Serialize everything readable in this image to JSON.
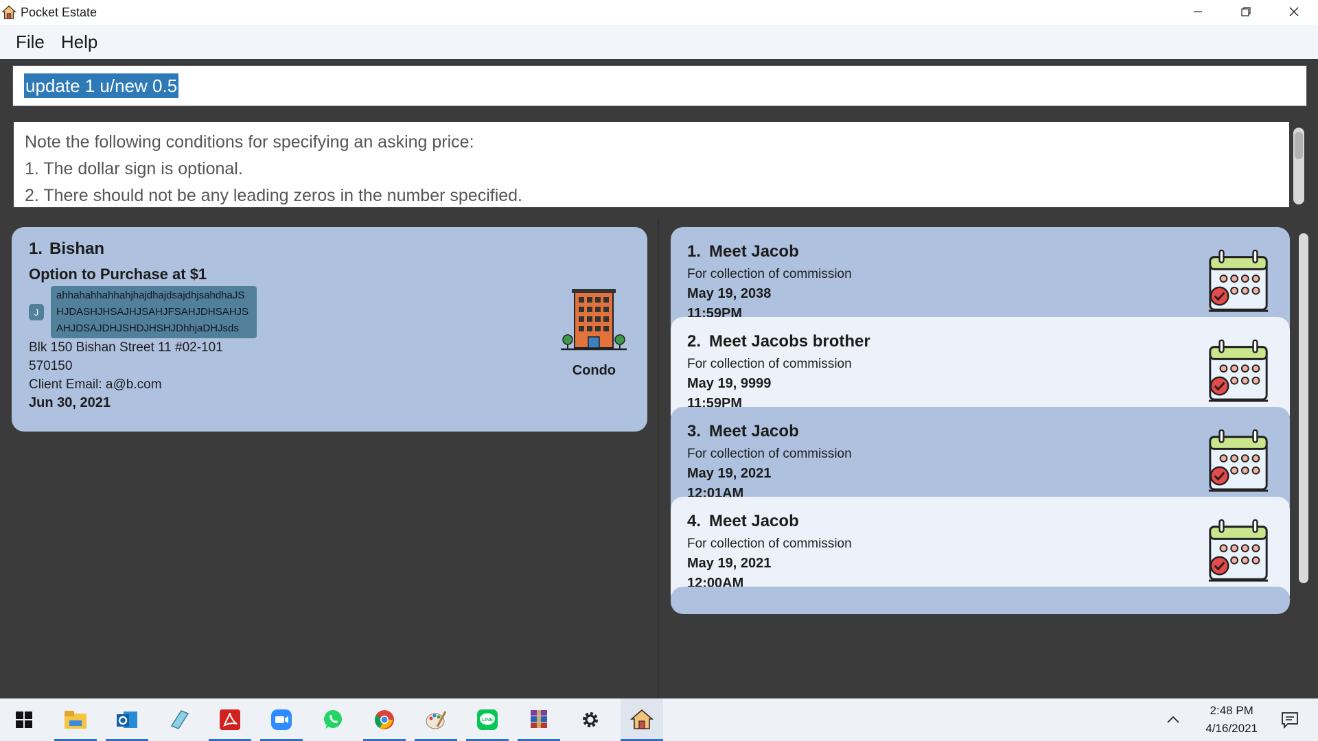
{
  "window": {
    "title": "Pocket Estate",
    "minimize_icon": "minimize-icon",
    "maximize_icon": "restore-icon",
    "close_icon": "close-icon"
  },
  "menu": {
    "items": [
      {
        "label": "File"
      },
      {
        "label": "Help"
      }
    ]
  },
  "command": {
    "value": "update 1 u/new 0.5"
  },
  "result": {
    "lines": [
      "Note the following conditions for specifying an asking price:",
      "1. The dollar sign is optional.",
      "2. There should not be any leading zeros in the number specified."
    ]
  },
  "properties": [
    {
      "index": "1.",
      "name": "Bishan",
      "status": "Option to Purchase at $1",
      "tags": [
        "J",
        "ahhahahhahhahjhajdhajdsajdhjsahdhaJSHJDASHJHSAJHJSAHJFSAHJDHSAHJSAHJDSAJDHJSHDJHSHJDhhjaDHJsds"
      ],
      "address": "Blk 150 Bishan Street 11 #02-101",
      "postal": "570150",
      "client_email": "Client Email: a@b.com",
      "deadline": "Jun 30, 2021",
      "type": "Condo",
      "type_icon": "condo-building-icon"
    }
  ],
  "appointments": [
    {
      "index": "1.",
      "name": "Meet Jacob",
      "remarks": "For collection of commission",
      "date": "May 19, 2038",
      "time": "11:59PM"
    },
    {
      "index": "2.",
      "name": "Meet Jacobs brother",
      "remarks": "For collection of commission",
      "date": "May 19, 9999",
      "time": "11:59PM"
    },
    {
      "index": "3.",
      "name": "Meet Jacob",
      "remarks": "For collection of commission",
      "date": "May 19, 2021",
      "time": "12:01AM"
    },
    {
      "index": "4.",
      "name": "Meet Jacob",
      "remarks": "For collection of commission",
      "date": "May 19, 2021",
      "time": "12:00AM"
    }
  ],
  "taskbar": {
    "apps": [
      "start-icon",
      "file-explorer-icon",
      "outlook-icon",
      "notepad-icon",
      "acrobat-icon",
      "zoom-icon",
      "whatsapp-icon",
      "chrome-icon",
      "paint-icon",
      "line-icon",
      "winrar-icon",
      "settings-icon",
      "pocket-estate-icon"
    ],
    "time": "2:48 PM",
    "date": "4/16/2021"
  },
  "colors": {
    "card_blue": "#aec1de",
    "card_light": "#edf2fa",
    "tag_bg": "#527f99",
    "selection": "#2e79b8",
    "dark_bg": "#3b3b3b"
  }
}
